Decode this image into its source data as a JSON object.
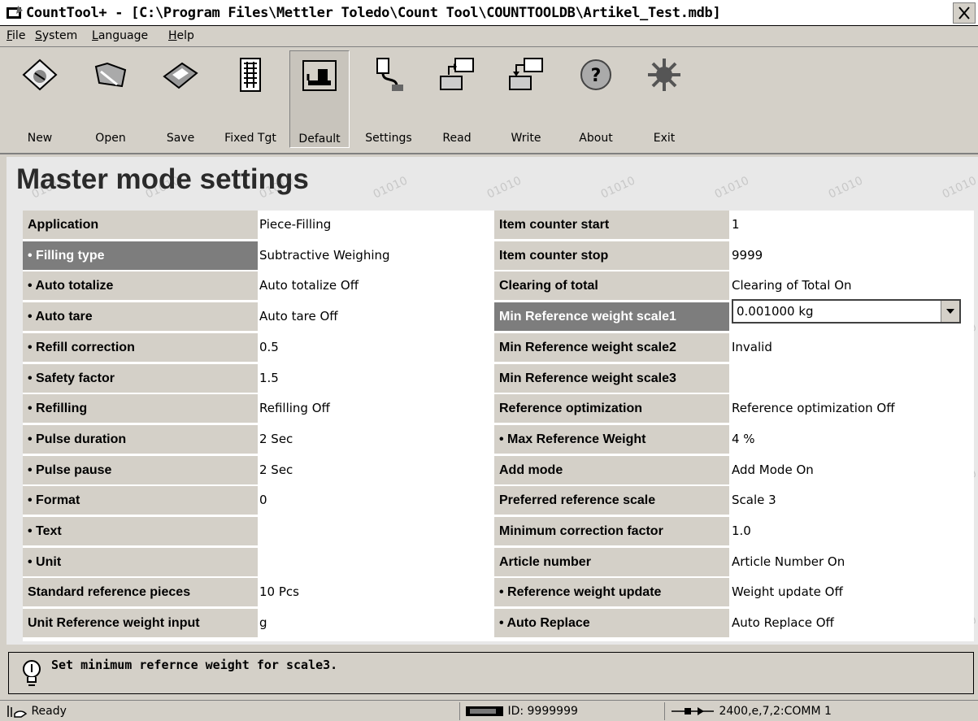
{
  "window": {
    "title": "CountTool+ - [C:\\Program Files\\Mettler Toledo\\Count Tool\\COUNTTOOLDB\\Artikel_Test.mdb]"
  },
  "menu": [
    "File",
    "System",
    "Language",
    "Help"
  ],
  "toolbar": [
    {
      "label": "New",
      "icon": "new-icon"
    },
    {
      "label": "Open",
      "icon": "open-icon"
    },
    {
      "label": "Save",
      "icon": "save-icon"
    },
    {
      "label": "Fixed Tgt",
      "icon": "fixed-target-icon"
    },
    {
      "label": "Default",
      "icon": "default-icon"
    },
    {
      "label": "Settings",
      "icon": "settings-icon"
    },
    {
      "label": "Read",
      "icon": "read-icon"
    },
    {
      "label": "Write",
      "icon": "write-icon"
    },
    {
      "label": "About",
      "icon": "about-icon"
    },
    {
      "label": "Exit",
      "icon": "exit-icon"
    }
  ],
  "panel": {
    "heading": "Master mode settings",
    "watermark": "01010"
  },
  "left": [
    {
      "label": "Application",
      "value": "Piece-Filling"
    },
    {
      "label": "• Filling type",
      "value": "Subtractive Weighing"
    },
    {
      "label": "• Auto totalize",
      "value": "Auto totalize Off"
    },
    {
      "label": "• Auto tare",
      "value": "Auto tare Off"
    },
    {
      "label": "• Refill correction",
      "value": "0.5"
    },
    {
      "label": "• Safety factor",
      "value": "1.5"
    },
    {
      "label": "• Refilling",
      "value": "Refilling Off"
    },
    {
      "label": "• Pulse duration",
      "value": "2 Sec"
    },
    {
      "label": "• Pulse pause",
      "value": "2 Sec"
    },
    {
      "label": "• Format",
      "value": "0"
    },
    {
      "label": "• Text",
      "value": ""
    },
    {
      "label": "• Unit",
      "value": ""
    },
    {
      "label": "Standard reference pieces",
      "value": "10 Pcs"
    },
    {
      "label": "Unit Reference weight input",
      "value": "g"
    }
  ],
  "right": [
    {
      "label": "Item counter start",
      "value": "1"
    },
    {
      "label": "Item counter stop",
      "value": "9999"
    },
    {
      "label": "Clearing of total",
      "value": "Clearing of Total On"
    },
    {
      "label": "Min Reference weight scale1",
      "value": "0.001000 kg"
    },
    {
      "label": "Min Reference weight scale2",
      "value": "Invalid"
    },
    {
      "label": "Min Reference weight scale3",
      "value": ""
    },
    {
      "label": "Reference optimization",
      "value": "Reference optimization Off"
    },
    {
      "label": "• Max Reference Weight",
      "value": "4 %"
    },
    {
      "label": "Add mode",
      "value": "Add Mode On"
    },
    {
      "label": "Preferred reference scale",
      "value": "Scale 3"
    },
    {
      "label": "Minimum correction factor",
      "value": "1.0"
    },
    {
      "label": "Article number",
      "value": "Article Number On"
    },
    {
      "label": "• Reference weight update",
      "value": "Weight update Off"
    },
    {
      "label": "• Auto Replace",
      "value": "Auto Replace Off"
    }
  ],
  "status": {
    "message": "Set minimum refernce weight for scale3.",
    "ready": "Ready",
    "id": "ID: 9999999",
    "comm": "2400,e,7,2:COMM 1"
  }
}
